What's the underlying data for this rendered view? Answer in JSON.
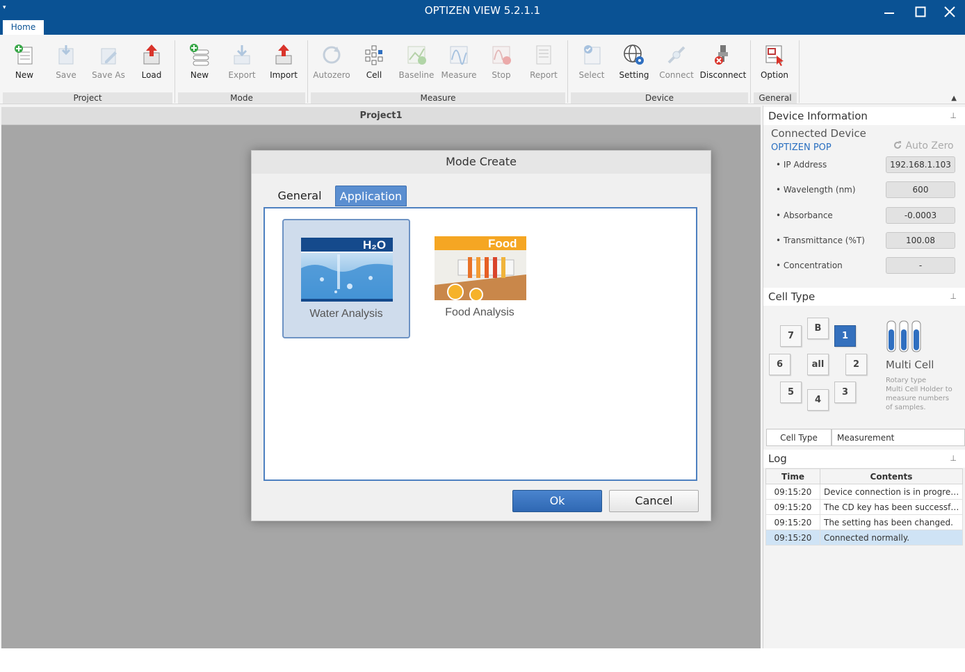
{
  "window": {
    "title": "OPTIZEN VIEW 5.2.1.1",
    "qat_glyph": "▾",
    "minimize": "—",
    "maximize": "☐",
    "close": "✕",
    "home_tab": "Home"
  },
  "ribbon": {
    "project": {
      "label": "Project",
      "new": "New",
      "save": "Save",
      "save_as": "Save As",
      "load": "Load"
    },
    "mode": {
      "label": "Mode",
      "new": "New",
      "export": "Export",
      "import": "Import"
    },
    "measure": {
      "label": "Measure",
      "autozero": "Autozero",
      "cell": "Cell",
      "baseline": "Baseline",
      "measure": "Measure",
      "stop": "Stop",
      "report": "Report"
    },
    "device": {
      "label": "Device",
      "select": "Select",
      "setting": "Setting",
      "connect": "Connect",
      "disconnect": "Disconnect"
    },
    "general": {
      "label": "General",
      "option": "Option"
    },
    "collapse_glyph": "▲"
  },
  "document": {
    "title": "Project1"
  },
  "dialog": {
    "title": "Mode Create",
    "tabs": {
      "general": "General",
      "application": "Application"
    },
    "tiles": [
      {
        "badge": "H₂O",
        "label": "Water Analysis"
      },
      {
        "badge": "Food",
        "label": "Food Analysis"
      }
    ],
    "ok": "Ok",
    "cancel": "Cancel"
  },
  "device_info": {
    "header": "Device Information",
    "pin": "⊥",
    "connected_device": "Connected Device",
    "device_name": "OPTIZEN POP",
    "auto_zero": "Auto Zero",
    "rows": [
      {
        "label": "• IP Address",
        "value": "192.168.1.103"
      },
      {
        "label": "• Wavelength (nm)",
        "value": "600"
      },
      {
        "label": "• Absorbance",
        "value": "-0.0003"
      },
      {
        "label": "• Transmittance (%T)",
        "value": "100.08"
      },
      {
        "label": "• Concentration",
        "value": "-"
      }
    ]
  },
  "cell_type": {
    "header": "Cell Type",
    "pin": "⊥",
    "buttons": {
      "b": "B",
      "c1": "1",
      "c2": "2",
      "c3": "3",
      "c4": "4",
      "c5": "5",
      "c6": "6",
      "c7": "7",
      "all": "all"
    },
    "name": "Multi Cell",
    "desc_line1": "Rotary type",
    "desc_line2": "Multi Cell Holder to",
    "desc_line3": "measure numbers",
    "desc_line4": "of samples.",
    "tab_cell_type": "Cell Type",
    "tab_measurement": "Measurement"
  },
  "log": {
    "header": "Log",
    "pin": "⊥",
    "columns": {
      "time": "Time",
      "contents": "Contents"
    },
    "rows": [
      {
        "time": "09:15:20",
        "contents": "Device connection is in progress..."
      },
      {
        "time": "09:15:20",
        "contents": "The CD key has been successfully..."
      },
      {
        "time": "09:15:20",
        "contents": "The setting has been changed."
      },
      {
        "time": "09:15:20",
        "contents": "Connected normally."
      }
    ]
  },
  "colors": {
    "titlebar": "#0a5294",
    "accent_blue": "#3470bd",
    "link_blue": "#2a6fc0",
    "selected_row": "#cfe3f5"
  }
}
